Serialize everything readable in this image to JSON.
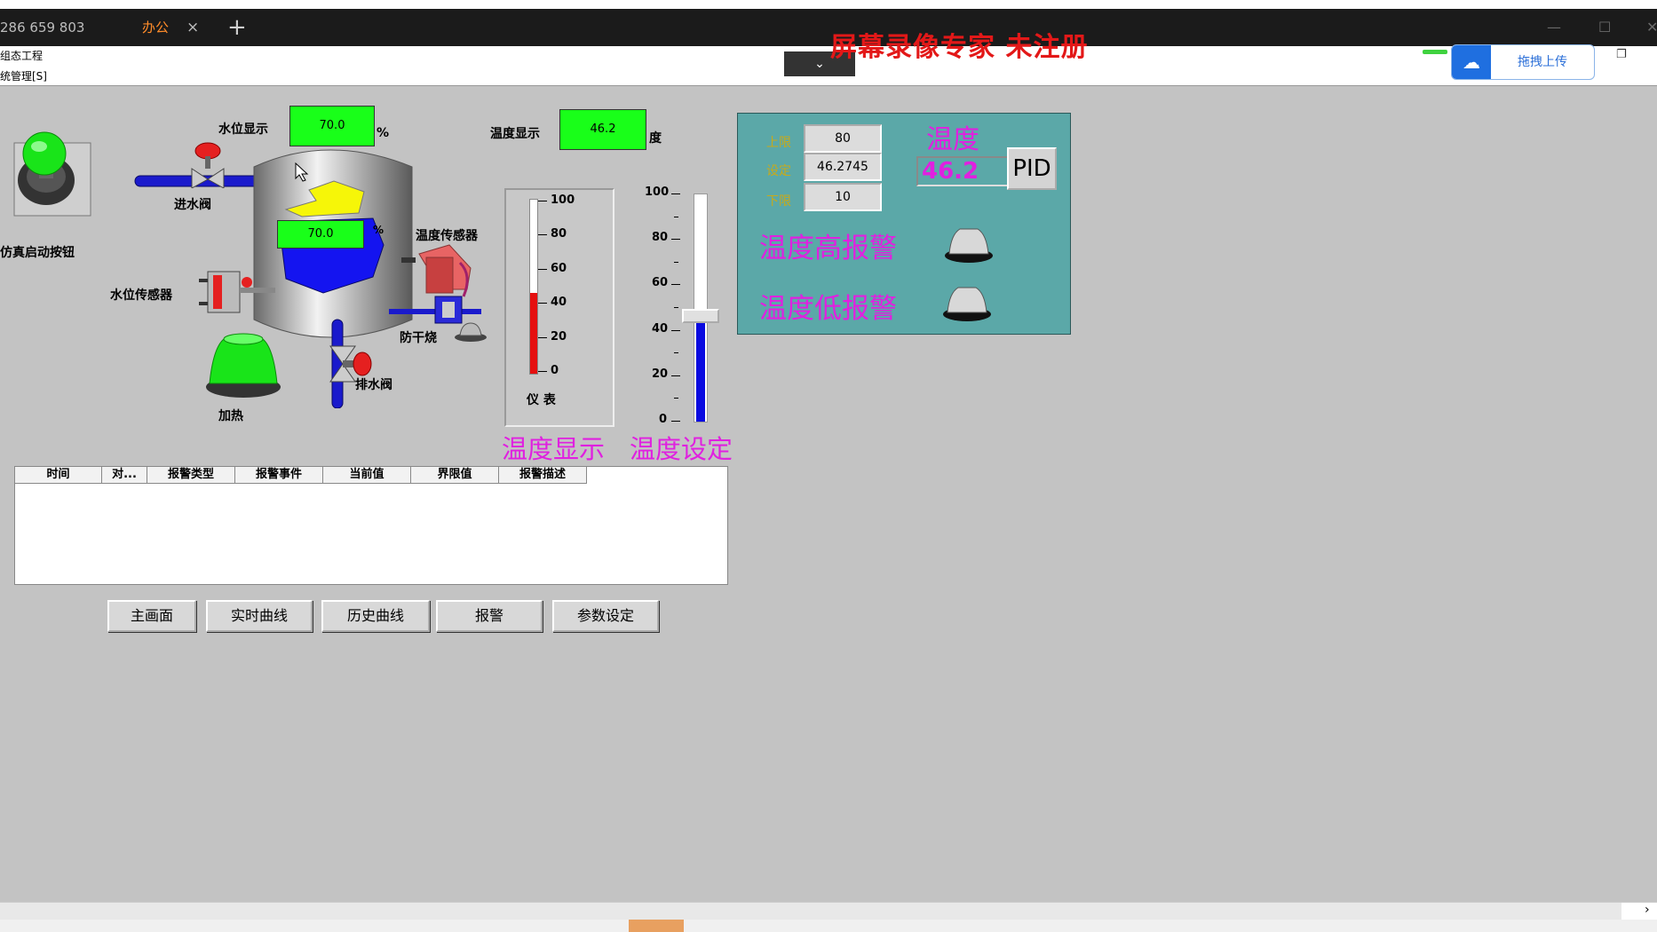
{
  "browser": {
    "tab_id_text": "286 659 803",
    "active_tab_label": "办公",
    "close_glyph": "×",
    "new_tab_glyph": "+",
    "watermark": "屏幕录像专家 未注册"
  },
  "menubar": {
    "line1": "组态工程",
    "line2": "统管理[S]",
    "dropdown_glyph": "⌄",
    "upload_label": "拖拽上传"
  },
  "process": {
    "water_level_label": "水位显示",
    "water_level_value": "70.0",
    "water_level_unit": "%",
    "tank_level_value": "70.0",
    "tank_level_unit": "%",
    "temp_display_label": "温度显示",
    "temp_display_value": "46.2",
    "temp_unit": "度",
    "sim_start_label": "仿真启动按钮",
    "inlet_valve_label": "进水阀",
    "level_sensor_label": "水位传感器",
    "temp_sensor_label": "温度传感器",
    "anti_dry_label": "防干烧",
    "heater_label": "加热",
    "drain_valve_label": "排水阀",
    "heater_color": "#19e419",
    "sim_button_color": "#19e419"
  },
  "thermometer": {
    "ticks": [
      "100",
      "80",
      "60",
      "40",
      "20",
      "0"
    ],
    "caption": "仪 表",
    "level_fraction": 0.462
  },
  "slider": {
    "ticks": [
      "100",
      "80",
      "60",
      "40",
      "20",
      "0"
    ],
    "level_fraction": 0.462
  },
  "captions": {
    "temp_display": "温度显示",
    "temp_setting": "温度设定"
  },
  "pid_panel": {
    "upper_label": "上限",
    "upper_value": "80",
    "set_label": "设定",
    "set_value": "46.2745",
    "lower_label": "下限",
    "lower_value": "10",
    "temp_title": "温度",
    "temp_value": "46.2",
    "pid_button": "PID",
    "high_alarm": "温度高报警",
    "low_alarm": "温度低报警"
  },
  "alarm_table": {
    "columns": [
      "时间",
      "对...",
      "报警类型",
      "报警事件",
      "当前值",
      "界限值",
      "报警描述"
    ]
  },
  "nav_buttons": [
    "主画面",
    "实时曲线",
    "历史曲线",
    "报警",
    "参数设定"
  ]
}
